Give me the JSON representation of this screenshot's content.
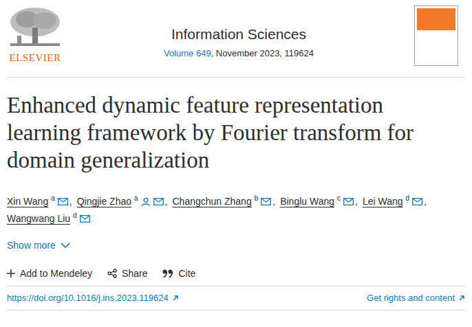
{
  "publisher": {
    "name": "ELSEVIER"
  },
  "journal": {
    "name": "Information Sciences",
    "volume": "Volume 649",
    "issue_info": ", November 2023, 119624"
  },
  "title_lines": [
    "Enhanced dynamic feature representation",
    "learning framework by Fourier transform for",
    "domain generalization"
  ],
  "authors": [
    {
      "name": "Xin Wang",
      "affiliation": "a",
      "corresponding": false,
      "separator": ","
    },
    {
      "name": "Qingjie Zhao",
      "affiliation": "a",
      "corresponding": true,
      "separator": ","
    },
    {
      "name": "Changchun Zhang",
      "affiliation": "b",
      "corresponding": false,
      "separator": ","
    },
    {
      "name": "Binglu Wang",
      "affiliation": "c",
      "corresponding": false,
      "separator": ","
    },
    {
      "name": "Lei Wang",
      "affiliation": "d",
      "corresponding": false,
      "separator": ","
    },
    {
      "name": "Wangwang Liu",
      "affiliation": "d",
      "corresponding": false,
      "separator": ""
    }
  ],
  "show_more": "Show more",
  "actions": [
    {
      "label": "Add to Mendeley",
      "kind": "add"
    },
    {
      "label": "Share",
      "kind": "share"
    },
    {
      "label": "Cite",
      "kind": "cite"
    }
  ],
  "doi": "https://doi.org/10.1016/j.ins.2023.119624",
  "rights": "Get rights and content"
}
